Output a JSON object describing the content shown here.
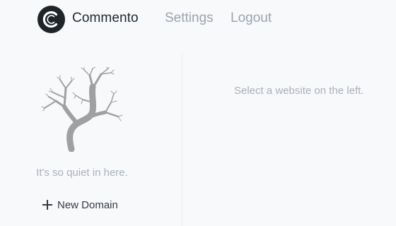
{
  "header": {
    "brand": "Commento",
    "nav": [
      {
        "label": "Settings"
      },
      {
        "label": "Logout"
      }
    ]
  },
  "sidebar": {
    "empty_message": "It's so quiet in here.",
    "new_domain_label": "New Domain"
  },
  "main": {
    "message": "Select a website on the left."
  }
}
